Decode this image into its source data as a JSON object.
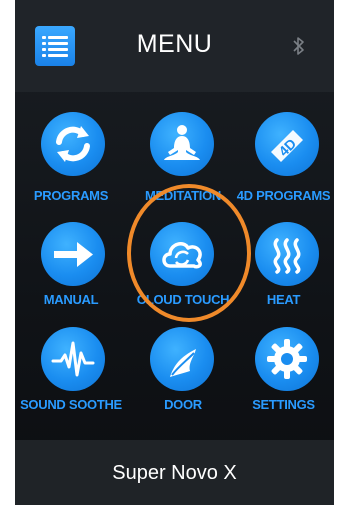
{
  "header": {
    "title": "MENU",
    "menu_icon": "list-icon",
    "status_icon": "bluetooth-icon"
  },
  "grid": [
    {
      "label": "PROGRAMS",
      "icon": "refresh-icon"
    },
    {
      "label": "MEDITATION",
      "icon": "meditation-icon"
    },
    {
      "label": "4D PROGRAMS",
      "icon": "4d-icon"
    },
    {
      "label": "MANUAL",
      "icon": "arrow-right-icon"
    },
    {
      "label": "CLOUD TOUCH",
      "icon": "cloud-sync-icon"
    },
    {
      "label": "HEAT",
      "icon": "heat-icon"
    },
    {
      "label": "SOUND SOOTHE",
      "icon": "soundwave-icon"
    },
    {
      "label": "DOOR",
      "icon": "door-icon"
    },
    {
      "label": "SETTINGS",
      "icon": "gear-icon"
    }
  ],
  "footer": {
    "label": "Super Novo X"
  },
  "colors": {
    "accent": "#1a8df0",
    "label": "#2a9bff",
    "highlight": "#f08a2a",
    "background": "#101317"
  }
}
